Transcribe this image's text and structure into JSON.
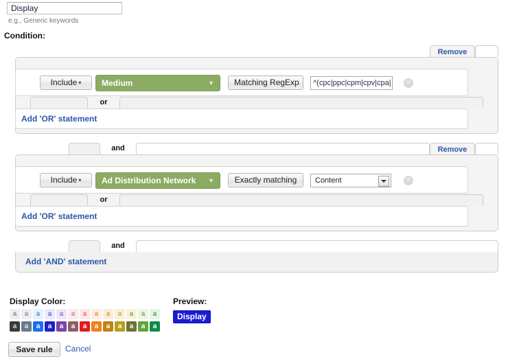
{
  "name_field": {
    "value": "Display",
    "placeholder": "",
    "hint": "e.g., Generic keywords"
  },
  "condition_label": "Condition:",
  "labels": {
    "remove": "Remove",
    "or": "or",
    "and": "and",
    "add_or": "Add 'OR' statement",
    "add_and": "Add 'AND' statement",
    "include": "Include",
    "caret": "▾",
    "green_caret": "▼",
    "clear_glyph": "✕"
  },
  "conditions": [
    {
      "include_label": "Include",
      "dimension": "Medium",
      "operator": "Matching RegExp",
      "value_type": "text",
      "value": "^(cpc|ppc|cpm|cpv|cpa|",
      "or_label": "or",
      "add_or_label": "Add 'OR' statement",
      "remove_label": "Remove"
    },
    {
      "include_label": "Include",
      "dimension": "Ad Distribution Network",
      "operator": "Exactly matching",
      "value_type": "select",
      "value": "Content",
      "or_label": "or",
      "add_or_label": "Add 'OR' statement",
      "remove_label": "Remove"
    }
  ],
  "display_color": {
    "label": "Display Color:",
    "swatch_letter": "a",
    "light_row": [
      {
        "bg": "#efefef",
        "fg": "#8a8a8a"
      },
      {
        "bg": "#eceef1",
        "fg": "#8e98a6"
      },
      {
        "bg": "#e8f0fe",
        "fg": "#5b8df0"
      },
      {
        "bg": "#e9e9fb",
        "fg": "#6a6ae0"
      },
      {
        "bg": "#efe7f7",
        "fg": "#9a6fc4"
      },
      {
        "bg": "#f9ecee",
        "fg": "#c98d96"
      },
      {
        "bg": "#fde9e9",
        "fg": "#ef6b6b"
      },
      {
        "bg": "#fdeee2",
        "fg": "#f09352"
      },
      {
        "bg": "#fbeed9",
        "fg": "#d9a23c"
      },
      {
        "bg": "#f8f1d8",
        "fg": "#c9b23e"
      },
      {
        "bg": "#f6f3dd",
        "fg": "#9aa04a"
      },
      {
        "bg": "#eef5e4",
        "fg": "#7fae5c"
      },
      {
        "bg": "#e7f3e9",
        "fg": "#51a169"
      }
    ],
    "dark_row": [
      {
        "bg": "#3a3a3a",
        "fg": "#d8d8d8"
      },
      {
        "bg": "#6b7a8c",
        "fg": "#e2e6eb"
      },
      {
        "bg": "#1d6df5",
        "fg": "#ffffff"
      },
      {
        "bg": "#2020c8",
        "fg": "#ffffff"
      },
      {
        "bg": "#7a45a8",
        "fg": "#ffffff"
      },
      {
        "bg": "#8d5f6a",
        "fg": "#ffffff"
      },
      {
        "bg": "#e01b1b",
        "fg": "#ffffff"
      },
      {
        "bg": "#ef8118",
        "fg": "#ffffff"
      },
      {
        "bg": "#bf8412",
        "fg": "#ffffff"
      },
      {
        "bg": "#b5a018",
        "fg": "#ffffff"
      },
      {
        "bg": "#6f7333",
        "fg": "#ffffff"
      },
      {
        "bg": "#5fa53a",
        "fg": "#ffffff"
      },
      {
        "bg": "#0f8a47",
        "fg": "#ffffff"
      }
    ]
  },
  "preview": {
    "label": "Preview:",
    "badge_text": "Display",
    "badge_bg": "#1b1bd6",
    "badge_fg": "#ffffff"
  },
  "footer": {
    "save_label": "Save rule",
    "cancel_label": "Cancel"
  }
}
